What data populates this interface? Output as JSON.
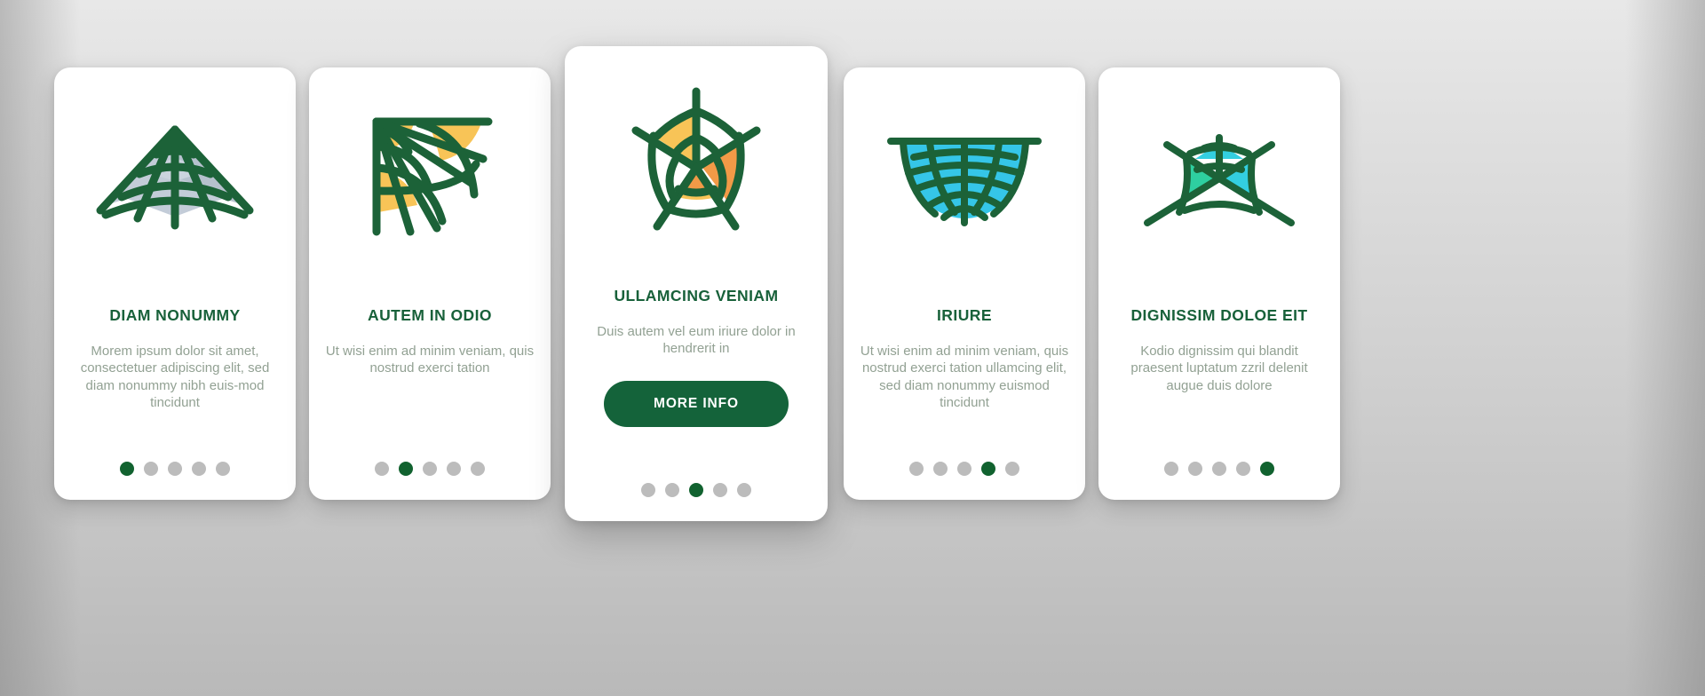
{
  "theme": {
    "accent_green": "#18613a",
    "button_green": "#14633a",
    "desc_gray": "#92a193",
    "dot_inactive": "#bcbcbc",
    "dot_active": "#11622f",
    "card_bg": "#ffffff",
    "page_bg": "#cfcfcf"
  },
  "cards": [
    {
      "id": "card-1",
      "icon_name": "spider-web-triangle-icon",
      "icon_fill": "#b9c4d0",
      "title": "DIAM NONUMMY",
      "description": "Morem ipsum dolor sit amet, consectetuer adipiscing elit, sed diam nonummy nibh euis-mod tincidunt",
      "dots_total": 5,
      "dot_active_index": 0,
      "has_button": false,
      "button_label": ""
    },
    {
      "id": "card-2",
      "icon_name": "spider-web-corner-icon",
      "icon_fill": "#f8c457",
      "title": "AUTEM IN ODIO",
      "description": "Ut wisi enim ad minim veniam, quis nostrud exerci tation",
      "dots_total": 5,
      "dot_active_index": 1,
      "has_button": false,
      "button_label": ""
    },
    {
      "id": "card-3",
      "icon_name": "spider-web-pentagon-icon",
      "icon_fill": "#f8c457",
      "icon_fill_alt": "#f29a47",
      "title": "ULLAMCING VENIAM",
      "description": "Duis autem vel eum iriure dolor in hendrerit in",
      "dots_total": 5,
      "dot_active_index": 2,
      "has_button": true,
      "button_label": "MORE INFO"
    },
    {
      "id": "card-4",
      "icon_name": "spider-web-hanging-icon",
      "icon_fill": "#35c6e8",
      "title": "IRIURE",
      "description": "Ut wisi enim ad minim veniam, quis nostrud exerci tation ullamcing elit, sed diam nonummy euismod tincidunt",
      "dots_total": 5,
      "dot_active_index": 3,
      "has_button": false,
      "button_label": ""
    },
    {
      "id": "card-5",
      "icon_name": "spider-web-canopy-icon",
      "icon_fill": "#2ecfa0",
      "icon_fill_alt": "#33cfe0",
      "title": "DIGNISSIM DOLOE EIT",
      "description": "Kodio dignissim qui blandit praesent luptatum zzril delenit augue duis dolore",
      "dots_total": 5,
      "dot_active_index": 4,
      "has_button": false,
      "button_label": ""
    }
  ]
}
